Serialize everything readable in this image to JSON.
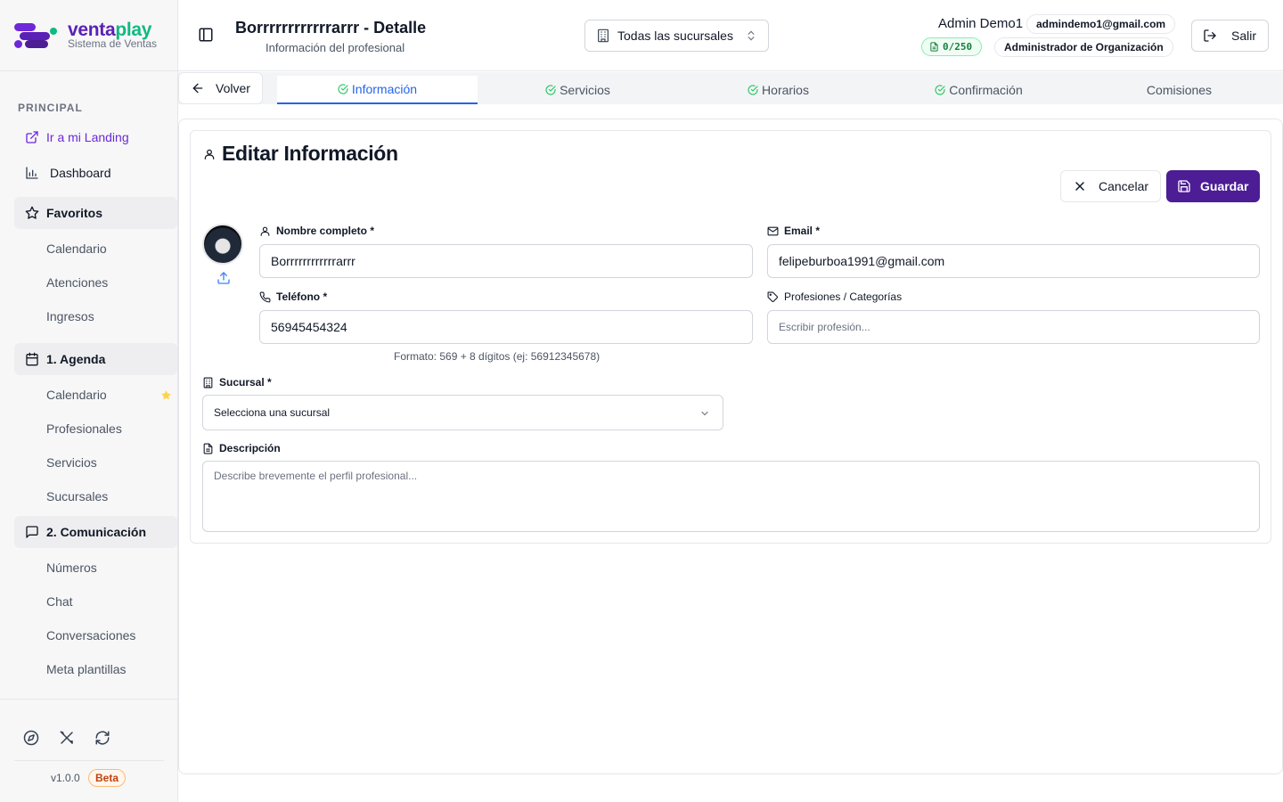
{
  "brand": {
    "name_part1": "venta",
    "name_part2": "play",
    "subtitle": "Sistema de Ventas",
    "colors": {
      "primary": "#5b21b6",
      "accent": "#10b981"
    }
  },
  "sidebar": {
    "section_label": "PRINCIPAL",
    "landing_link": "Ir a mi Landing",
    "dashboard": "Dashboard",
    "favorites": {
      "label": "Favoritos",
      "items": [
        "Calendario",
        "Atenciones",
        "Ingresos"
      ]
    },
    "agenda": {
      "label": "1. Agenda",
      "items": [
        "Calendario",
        "Profesionales",
        "Servicios",
        "Sucursales"
      ]
    },
    "comunicacion": {
      "label": "2. Comunicación",
      "items": [
        "Números",
        "Chat",
        "Conversaciones",
        "Meta plantillas"
      ]
    },
    "footer": {
      "icons": [
        "compass-icon",
        "tools-icon",
        "refresh-icon"
      ],
      "version": "v1.0.0",
      "badge": "Beta"
    }
  },
  "header": {
    "title": "Borrrrrrrrrrrrarrr - Detalle",
    "subtitle": "Información del profesional",
    "branch_selector": "Todas las sucursales",
    "user_name": "Admin Demo1",
    "user_email": "admindemo1@gmail.com",
    "credits": "0/250",
    "role": "Administrador de Organización",
    "logout": "Salir"
  },
  "tabs": {
    "back": "Volver",
    "items": [
      {
        "label": "Información",
        "checked": true,
        "active": true
      },
      {
        "label": "Servicios",
        "checked": true,
        "active": false
      },
      {
        "label": "Horarios",
        "checked": true,
        "active": false
      },
      {
        "label": "Confirmación",
        "checked": true,
        "active": false
      },
      {
        "label": "Comisiones",
        "checked": false,
        "active": false
      }
    ],
    "active_color": "#2563eb"
  },
  "form": {
    "title": "Editar Información",
    "cancel": "Cancelar",
    "save": "Guardar",
    "save_color": "#4c1d95",
    "name": {
      "label": "Nombre completo *",
      "value": "Borrrrrrrrrrrrarrr"
    },
    "email": {
      "label": "Email *",
      "value": "felipeburboa1991@gmail.com"
    },
    "phone": {
      "label": "Teléfono *",
      "value": "56945454324",
      "hint": "Formato: 569 + 8 dígitos (ej: 56912345678)"
    },
    "professions": {
      "label": "Profesiones / Categorías",
      "placeholder": "Escribir profesión..."
    },
    "branch": {
      "label": "Sucursal *",
      "value": "Selecciona una sucursal"
    },
    "description": {
      "label": "Descripción",
      "placeholder": "Describe brevemente el perfil profesional..."
    }
  }
}
